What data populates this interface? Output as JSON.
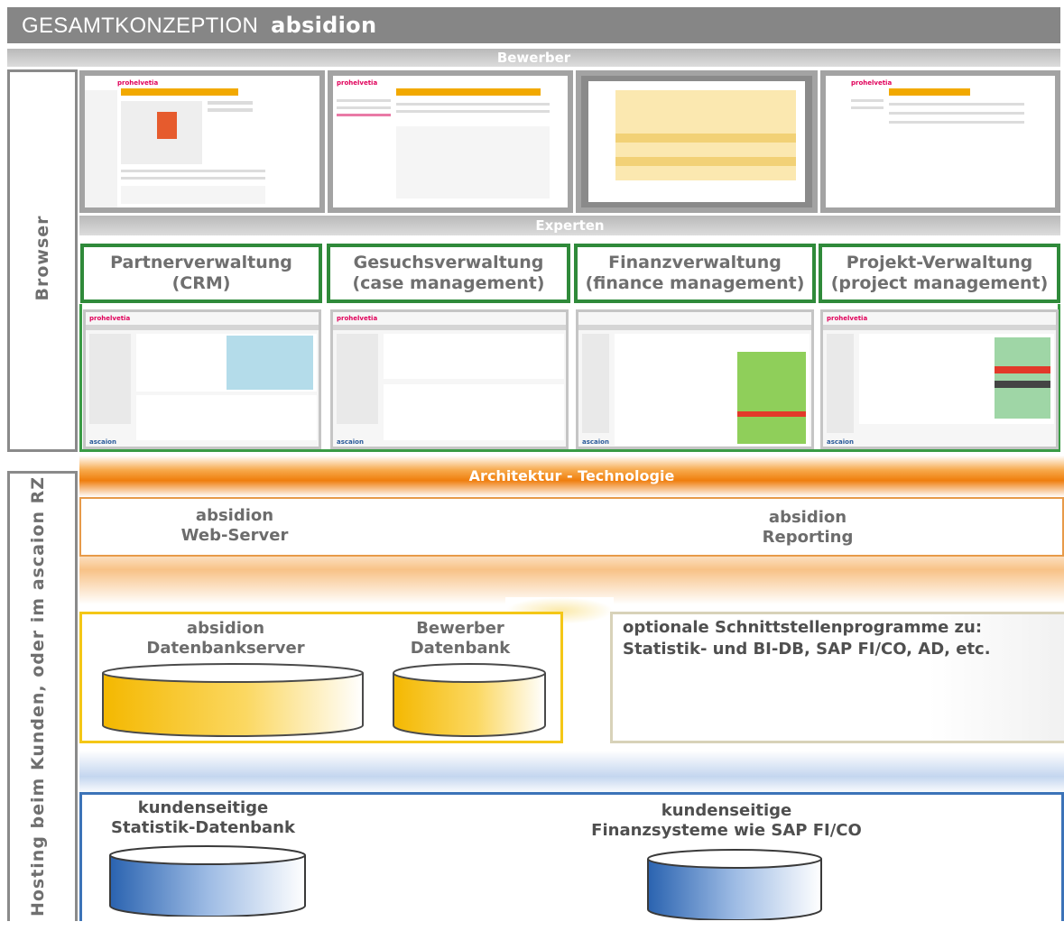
{
  "title": {
    "prefix": "GESAMTKONZEPTION",
    "product": "absidion"
  },
  "bands": {
    "bewerber": "Bewerber",
    "experten": "Experten",
    "architektur": "Architektur - Technologie"
  },
  "side_labels": {
    "browser": "Browser",
    "hosting": "Hosting beim Kunden,  oder im ascaion RZ"
  },
  "modules": [
    {
      "line1": "Partnerverwaltung",
      "line2": "(CRM)"
    },
    {
      "line1": "Gesuchsverwaltung",
      "line2": "(case management)"
    },
    {
      "line1": "Finanzverwaltung",
      "line2": "(finance management)"
    },
    {
      "line1": "Projekt-Verwaltung",
      "line2": "(project management)"
    }
  ],
  "screens": {
    "brand": "prohelvetia",
    "logo": "ascaion"
  },
  "server": {
    "web_line1": "absidion",
    "web_line2": "Web-Server",
    "rep_line1": "absidion",
    "rep_line2": "Reporting"
  },
  "databases": {
    "db_line1": "absidion",
    "db_line2": "Datenbankserver",
    "bew_line1": "Bewerber",
    "bew_line2": "Datenbank",
    "opt_line1": "optionale Schnittstellenprogramme zu:",
    "opt_line2": "Statistik- und BI-DB, SAP FI/CO, AD, etc."
  },
  "customer": {
    "stat_line1": "kundenseitige",
    "stat_line2": "Statistik-Datenbank",
    "fin_line1": "kundenseitige",
    "fin_line2": "Finanzsysteme wie SAP FI/CO"
  },
  "colors": {
    "green": "#2f8a3a",
    "orange": "#ef7e0d",
    "yellow": "#f4c716",
    "blue": "#3c73b8",
    "grey": "#868686"
  }
}
